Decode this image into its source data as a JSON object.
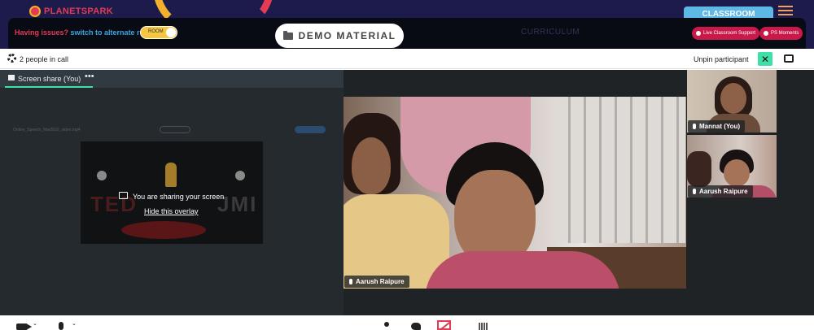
{
  "header": {
    "logo_text": "PLANETSPARK",
    "issues_question": "Having issues?",
    "issues_switch": "switch to alternate room",
    "toggle_label": "ROOM",
    "demo_material_label": "DEMO MATERIAL",
    "curriculum_label": "CURRICULUM",
    "classroom_tab": "CLASSROOM",
    "live_support_label": "Live Classroom Support",
    "ps_moments_label": "PS Moments"
  },
  "call_bar": {
    "people_count": "2 people in call",
    "unpin_label": "Unpin participant",
    "unpin_icon_glyph": "✕"
  },
  "screen_share": {
    "tab_label": "Screen share (You)",
    "more_glyph": "•••",
    "sharing_message": "You are sharing your screen",
    "hide_overlay_label": "Hide this overlay",
    "preview_file_name": "Online_Speech_Mar2022_video.mp4",
    "preview_text_left": "TED",
    "preview_text_right": "JMI"
  },
  "participants": {
    "main_name": "Aarush Raipure",
    "tile_1_name": "Mannat (You)",
    "tile_2_name": "Aarush Raipure"
  },
  "colors": {
    "brand_navy": "#1d1b4b",
    "brand_red": "#e23b53",
    "accent_green": "#3ee0a8",
    "classroom_blue": "#5eb8e6",
    "toggle_yellow": "#f4c742"
  },
  "icons": {
    "settings": "gear-icon",
    "unpin": "close-icon",
    "layout": "layout-icon",
    "camera": "camera-icon",
    "microphone": "mic-icon",
    "participants": "person-icon",
    "chat": "chat-icon",
    "screen_share": "stop-share-icon",
    "grid": "grid-icon"
  },
  "toolbar": {
    "caret_glyph": "⌄"
  }
}
